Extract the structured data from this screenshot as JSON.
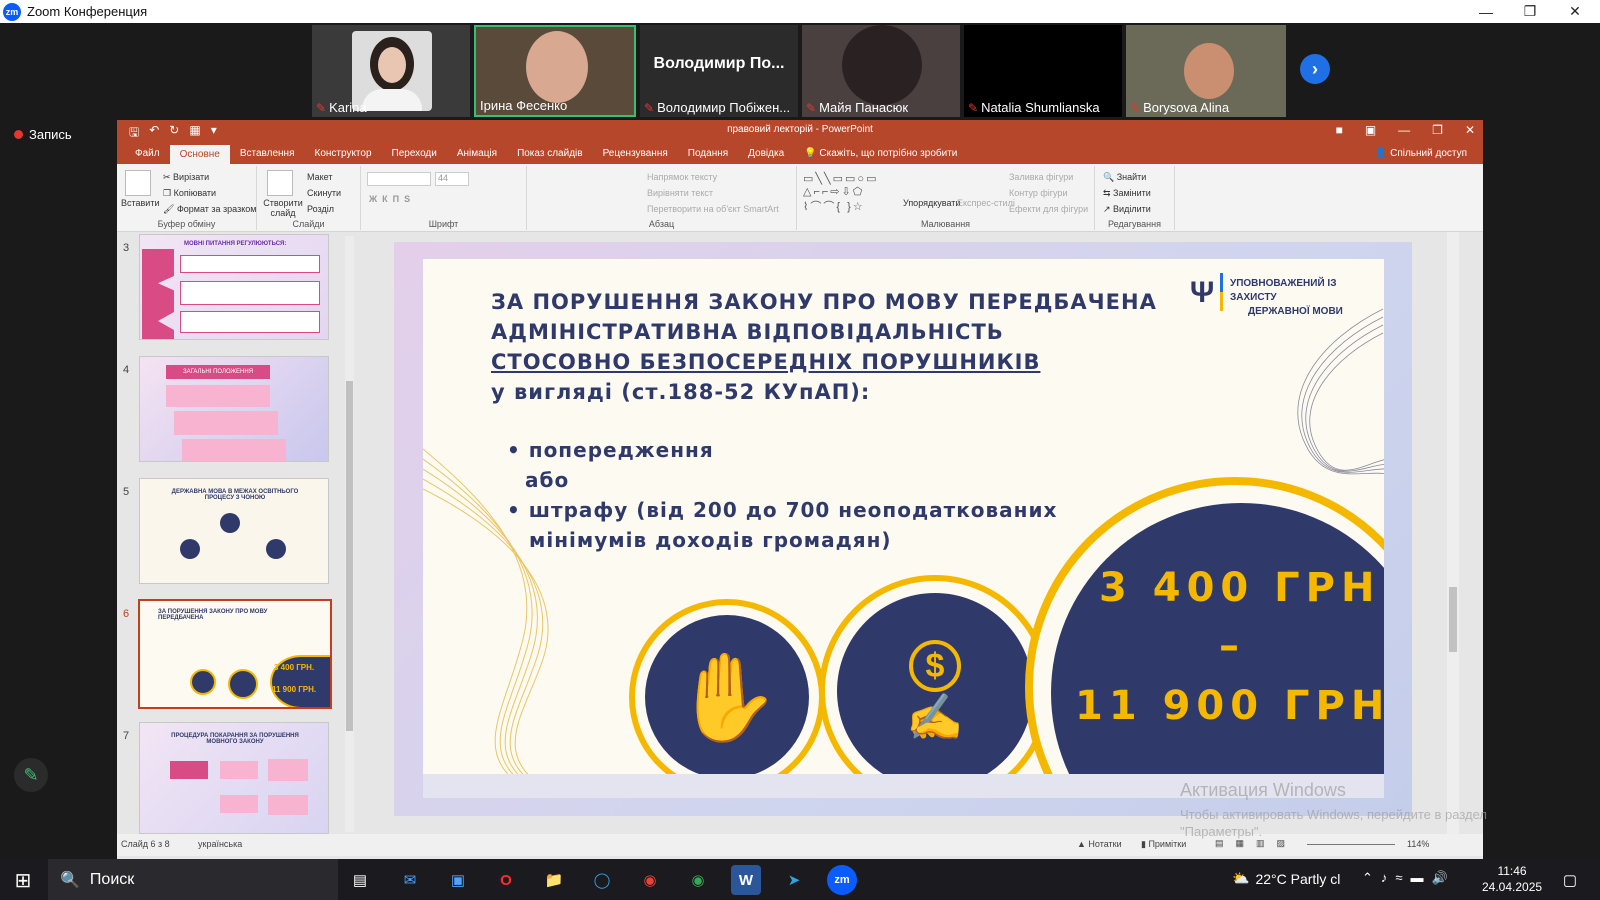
{
  "zoom": {
    "title": "Zoom Конференция",
    "record_label": "Запись",
    "logo": "zm"
  },
  "participants": [
    {
      "name": "Karina"
    },
    {
      "name": "Ірина Фесенко"
    },
    {
      "name": "Володимир Побіжен...",
      "big_label": "Володимир По..."
    },
    {
      "name": "Майя Панасюк"
    },
    {
      "name": "Natalia Shumlianska"
    },
    {
      "name": "Borysova Alina"
    }
  ],
  "ppt": {
    "title": "правовий лекторій - PowerPoint",
    "tabs": [
      "Файл",
      "Основне",
      "Вставлення",
      "Конструктор",
      "Переходи",
      "Анімація",
      "Показ слайдів",
      "Рецензування",
      "Подання",
      "Довідка"
    ],
    "tell_me": "Скажіть, що потрібно зробити",
    "share": "Спільний доступ",
    "ribbon": {
      "clipboard": {
        "paste": "Вставити",
        "cut": "Вирізати",
        "copy": "Копіювати",
        "format": "Формат за зразком",
        "label": "Буфер обміну"
      },
      "slides": {
        "new": "Створити слайд",
        "layout": "Макет",
        "reset": "Скинути",
        "section": "Розділ",
        "label": "Слайди"
      },
      "font": {
        "size": "44",
        "label": "Шрифт"
      },
      "paragraph": {
        "dir": "Напрямок тексту",
        "align": "Вирівняти текст",
        "smartart": "Перетворити на об'єкт SmartArt",
        "label": "Абзац"
      },
      "drawing": {
        "arrange": "Упорядкувати",
        "styles": "Експрес-стилі",
        "fill": "Заливка фігури",
        "outline": "Контур фігури",
        "effects": "Ефекти для фігури",
        "label": "Малювання"
      },
      "editing": {
        "find": "Знайти",
        "replace": "Замінити",
        "select": "Виділити",
        "label": "Редагування"
      }
    },
    "thumbs": [
      {
        "num": "3",
        "title": "МОВНІ ПИТАННЯ РЕГУЛЮЮТЬСЯ:"
      },
      {
        "num": "4",
        "title": "ЗАГАЛЬНІ ПОЛОЖЕННЯ"
      },
      {
        "num": "5",
        "title": "ДЕРЖАВНА МОВА В МЕЖАХ ОСВІТНЬОГО ПРОЦЕСУ З ЧОНОЮ"
      },
      {
        "num": "6",
        "title": "ЗА ПОРУШЕННЯ ЗАКОНУ ПРО МОВУ ПЕРЕДБАЧЕНА",
        "amount1": "3 400 ГРН.",
        "amount2": "11 900 ГРН."
      },
      {
        "num": "7",
        "title": "ПРОЦЕДУРА ПОКАРАННЯ ЗА ПОРУШЕННЯ МОВНОГО ЗАКОНУ"
      }
    ],
    "slide": {
      "line1": "ЗА ПОРУШЕННЯ ЗАКОНУ ПРО МОВУ ПЕРЕДБАЧЕНА",
      "line2": "АДМІНІСТРАТИВНА ВІДПОВІДАЛЬНІСТЬ",
      "line3": "СТОСОВНО БЕЗПОСЕРЕДНІХ ПОРУШНИКІВ",
      "line4": "у вигляді (ст.188-52 КУпАП):",
      "bullet1": "попередження",
      "or": "або",
      "bullet2a": "штрафу (від 200 до 700 неоподаткованих",
      "bullet2b": "мінімумів доходів громадян)",
      "logo_text1": "УПОВНОВАЖЕНИЙ ІЗ ЗАХИСТУ",
      "logo_text2": "ДЕРЖАВНОЇ МОВИ",
      "amount1": "3 400 ГРН.",
      "dash": "–",
      "amount2": "11 900 ГРН."
    },
    "status": {
      "slide": "Слайд 6 з 8",
      "lang": "українська",
      "notes": "Нотатки",
      "comments": "Примітки",
      "zoom": "114%"
    }
  },
  "activation": {
    "title": "Активация Windows",
    "sub1": "Чтобы активировать Windows, перейдите в раздел",
    "sub2": "\"Параметры\"."
  },
  "taskbar": {
    "search": "Поиск",
    "weather": "22°C  Partly cl",
    "time": "11:46",
    "date": "24.04.2025"
  },
  "colors": {
    "ppt_accent": "#b7472a",
    "navy": "#2f3a6b",
    "gold": "#f5b800",
    "record": "#e5372e"
  }
}
